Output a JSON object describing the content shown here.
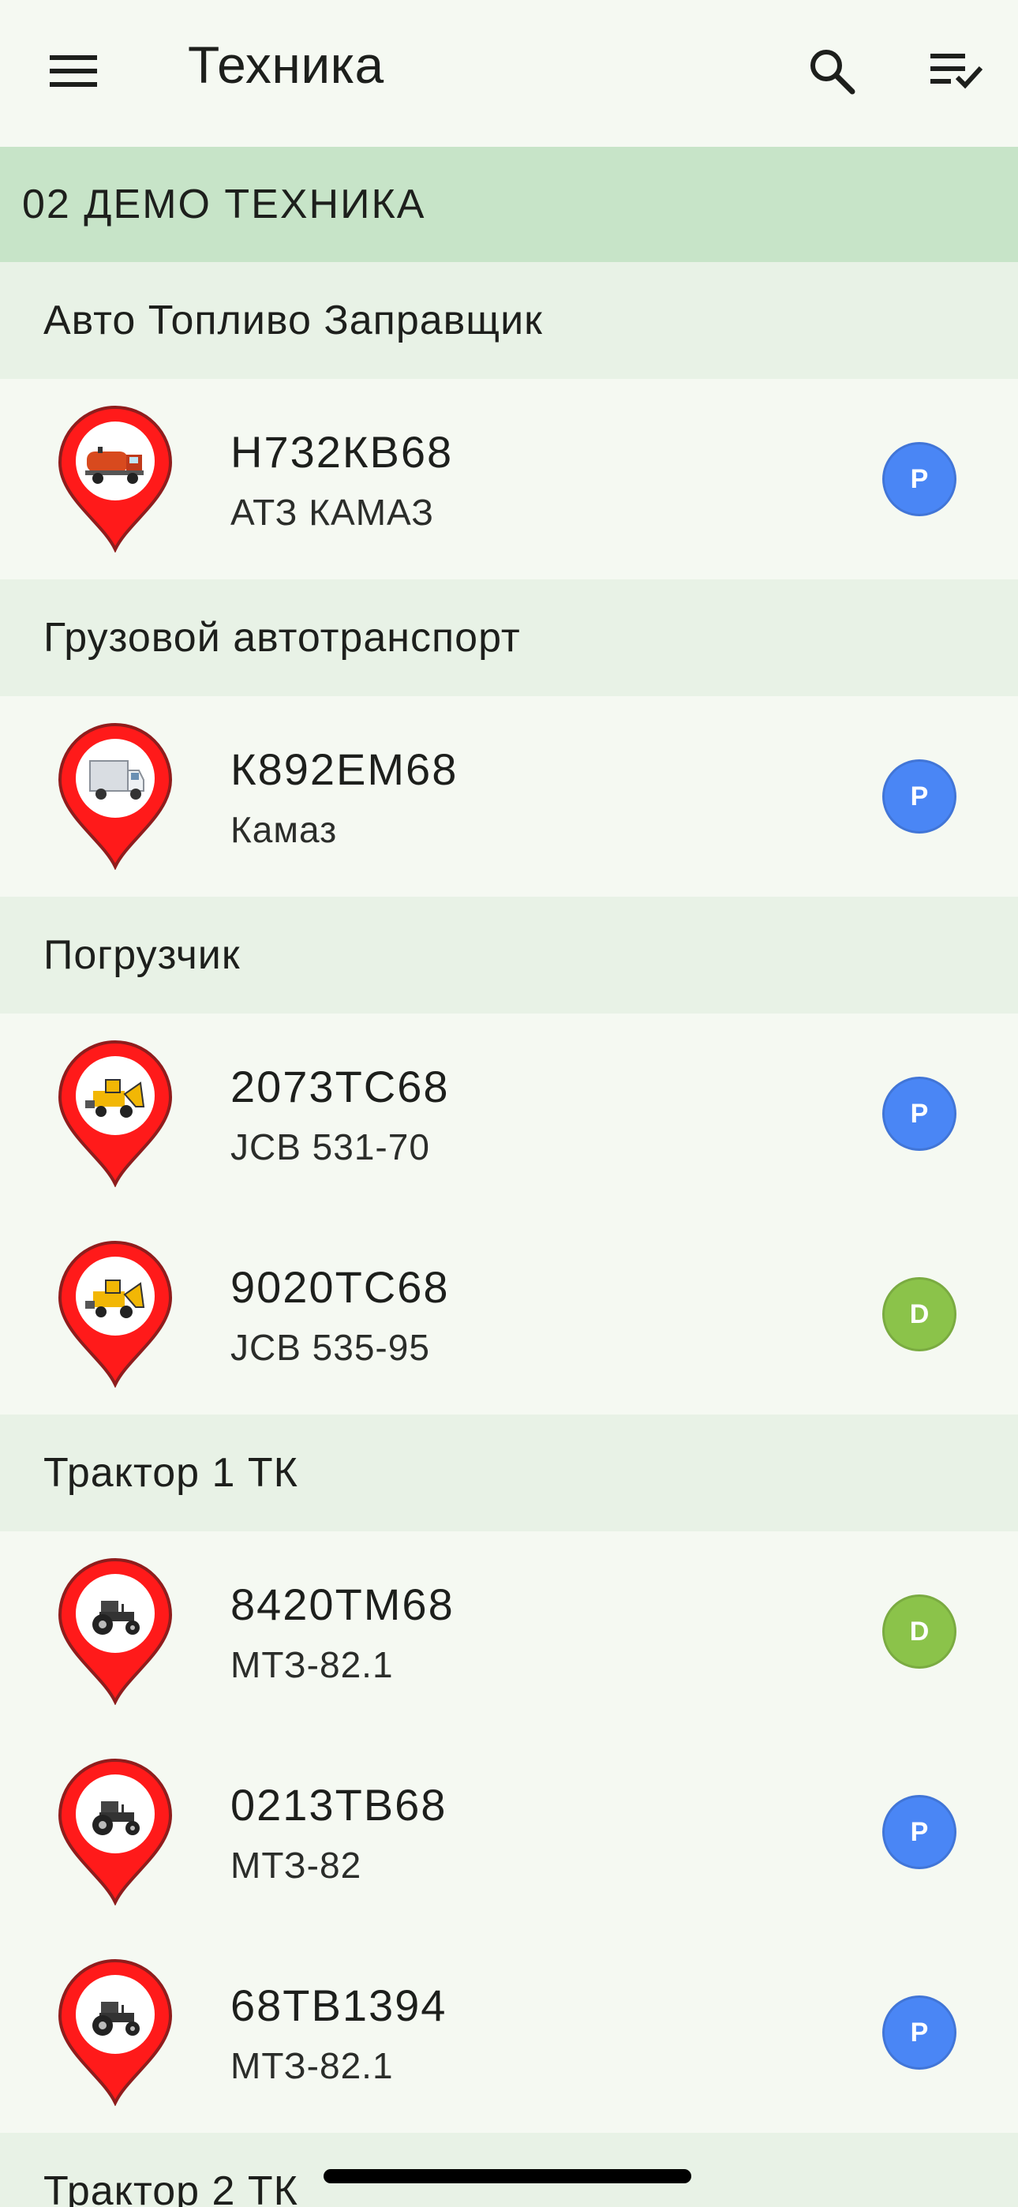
{
  "app_bar": {
    "title": "Техника",
    "menu_icon": "menu-icon",
    "search_icon": "search-icon",
    "sort_icon": "checklist-icon"
  },
  "group": {
    "label": "02 ДЕМО ТЕХНИКА"
  },
  "colors": {
    "pin_red": "#ff1a1a",
    "badge_p": "#4a86f5",
    "badge_d": "#8bc34a",
    "group_header_bg": "#c7e4c8",
    "category_bg": "#e8f2e6"
  },
  "categories": [
    {
      "label": "Авто Топливо Заправщик",
      "items": [
        {
          "plate": "Н732КВ68",
          "model": "АТЗ КАМАЗ",
          "icon": "fuel-truck-icon",
          "status": "P"
        }
      ]
    },
    {
      "label": "Грузовой автотранспорт",
      "items": [
        {
          "plate": "К892ЕМ68",
          "model": "Камаз",
          "icon": "cargo-truck-icon",
          "status": "P"
        }
      ]
    },
    {
      "label": "Погрузчик",
      "items": [
        {
          "plate": "2073ТС68",
          "model": "JCB 531-70",
          "icon": "loader-icon",
          "status": "P"
        },
        {
          "plate": "9020ТС68",
          "model": "JCB 535-95",
          "icon": "loader-icon",
          "status": "D"
        }
      ]
    },
    {
      "label": "Трактор 1 ТК",
      "items": [
        {
          "plate": "8420ТМ68",
          "model": "МТЗ-82.1",
          "icon": "tractor-icon",
          "status": "D"
        },
        {
          "plate": "0213ТВ68",
          "model": "МТЗ-82",
          "icon": "tractor-icon",
          "status": "P"
        },
        {
          "plate": "68ТВ1394",
          "model": "МТЗ-82.1",
          "icon": "tractor-icon",
          "status": "P"
        }
      ]
    },
    {
      "label": "Трактор 2 ТК",
      "items": []
    }
  ]
}
